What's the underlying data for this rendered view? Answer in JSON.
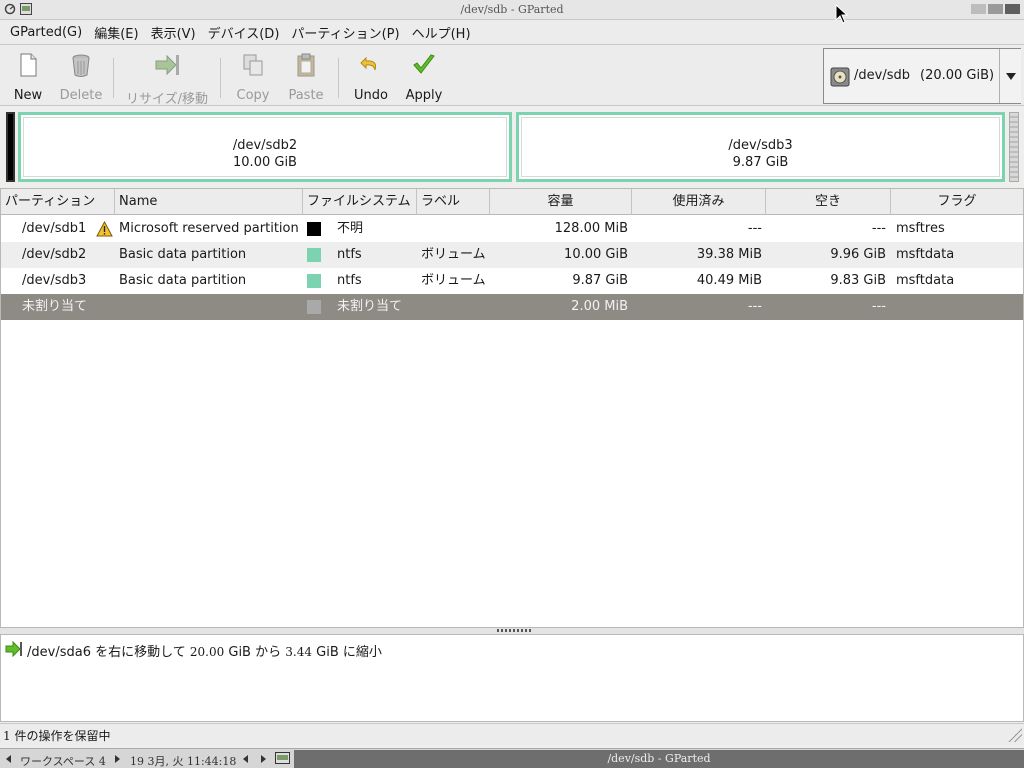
{
  "window": {
    "title": "/dev/sdb - GParted"
  },
  "menubar": {
    "items": [
      "GParted(G)",
      "編集(E)",
      "表示(V)",
      "デバイス(D)",
      "パーティション(P)",
      "ヘルプ(H)"
    ]
  },
  "toolbar": {
    "new": "New",
    "delete": "Delete",
    "resize": "リサイズ/移動",
    "copy": "Copy",
    "paste": "Paste",
    "undo": "Undo",
    "apply": "Apply"
  },
  "device_selector": {
    "device": "/dev/sdb",
    "size": "(20.00 GiB)"
  },
  "disk_map": {
    "partitions": [
      {
        "name": "/dev/sdb2",
        "size": "10.00 GiB"
      },
      {
        "name": "/dev/sdb3",
        "size": "9.87 GiB"
      }
    ]
  },
  "table": {
    "headers": [
      "パーティション",
      "Name",
      "ファイルシステム",
      "ラベル",
      "容量",
      "使用済み",
      "空き",
      "フラグ"
    ],
    "rows": [
      {
        "partition": "/dev/sdb1",
        "warning": true,
        "name": "Microsoft reserved partition",
        "fs_color": "#000000",
        "filesystem": "不明",
        "label": "",
        "size": "128.00 MiB",
        "used": "---",
        "unused": "---",
        "flags": "msftres"
      },
      {
        "partition": "/dev/sdb2",
        "warning": false,
        "name": "Basic data partition",
        "fs_color": "#7bd3b0",
        "filesystem": "ntfs",
        "label": "ボリューム",
        "size": "10.00 GiB",
        "used": "39.38 MiB",
        "unused": "9.96 GiB",
        "flags": "msftdata"
      },
      {
        "partition": "/dev/sdb3",
        "warning": false,
        "name": "Basic data partition",
        "fs_color": "#7bd3b0",
        "filesystem": "ntfs",
        "label": "ボリューム",
        "size": "9.87 GiB",
        "used": "40.49 MiB",
        "unused": "9.83 GiB",
        "flags": "msftdata"
      },
      {
        "partition": "未割り当て",
        "warning": false,
        "name": "",
        "fs_color": "#a9a9a9",
        "filesystem": "未割り当て",
        "label": "",
        "size": "2.00 MiB",
        "used": "---",
        "unused": "---",
        "flags": "",
        "selected": true
      }
    ]
  },
  "operations": {
    "items": [
      {
        "device": "/dev/sda6",
        "text1": "を右に移動して",
        "from": "20.00",
        "unit1": "GiB",
        "text2": "から",
        "to": "3.44",
        "unit2": "GiB",
        "text3": "に縮小"
      }
    ]
  },
  "statusbar": {
    "text": "1 件の操作を保留中"
  },
  "taskbar": {
    "workspace": "ワークスペース 4",
    "datetime": "19 3月, 火 11:44:18",
    "window_title": "/dev/sdb - GParted"
  },
  "colors": {
    "ntfs": "#7bd3b0",
    "unallocated": "#a9a9a9",
    "selected_row": "#8e8b84"
  }
}
